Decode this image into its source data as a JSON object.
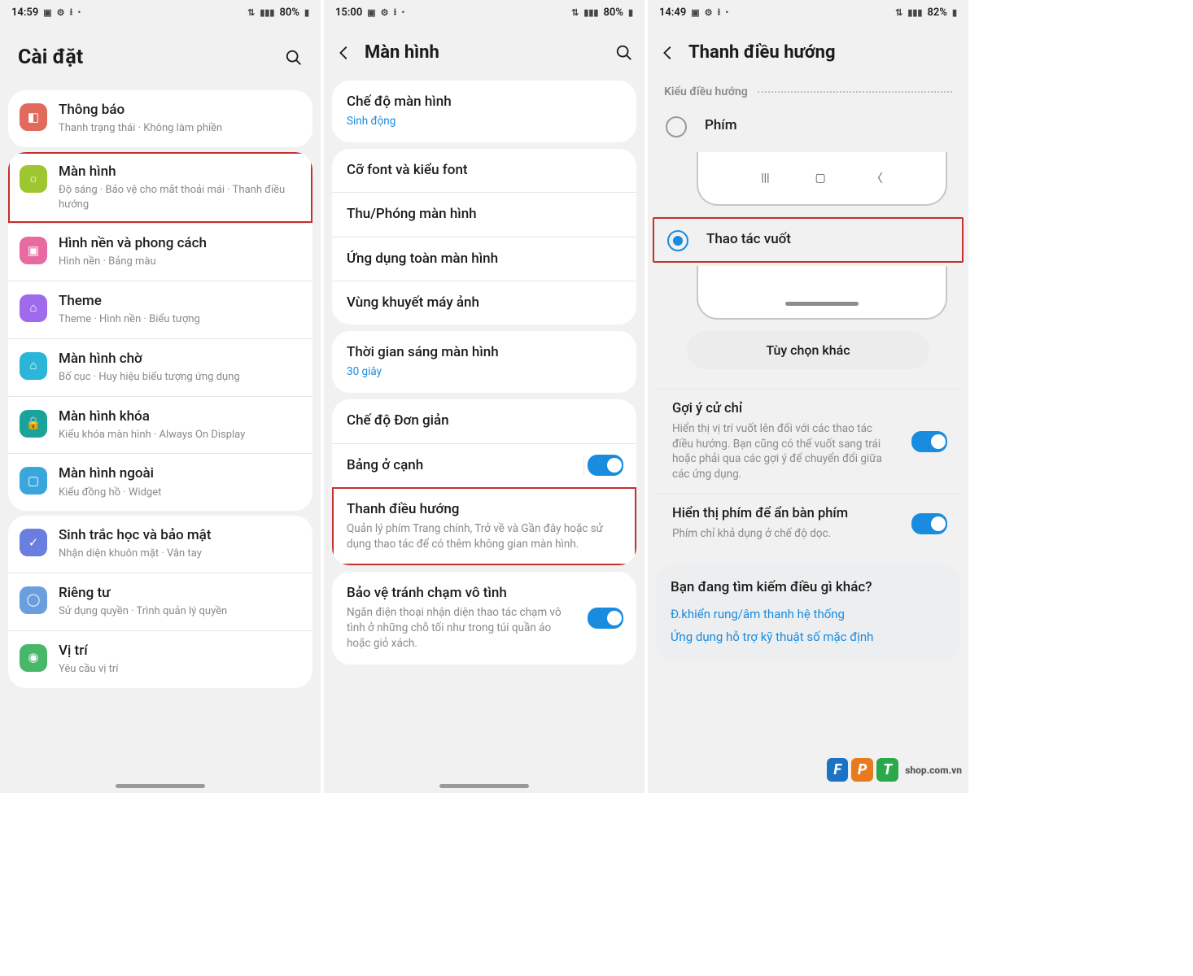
{
  "pane1": {
    "status": {
      "time": "14:59",
      "battery": "80%",
      "icons": [
        "image",
        "gear",
        "download",
        "dot"
      ]
    },
    "title": "Cài đặt",
    "groups": [
      [
        {
          "icon_bg": "#e26a5c",
          "glyph": "◧",
          "title": "Thông báo",
          "sub": "Thanh trạng thái  ·  Không làm phiền"
        }
      ],
      [
        {
          "icon_bg": "#9ec631",
          "glyph": "☼",
          "title": "Màn hình",
          "sub": "Độ sáng  ·  Bảo vệ cho mắt thoải mái  ·  Thanh điều hướng",
          "highlight": true
        },
        {
          "icon_bg": "#e76aa0",
          "glyph": "▣",
          "title": "Hình nền và phong cách",
          "sub": "Hình nền  ·  Bảng màu"
        },
        {
          "icon_bg": "#9f6aec",
          "glyph": "⌂",
          "title": "Theme",
          "sub": "Theme  ·  Hình nền  ·  Biểu tượng"
        },
        {
          "icon_bg": "#2bb5d8",
          "glyph": "⌂",
          "title": "Màn hình chờ",
          "sub": "Bố cục  ·  Huy hiệu biểu tượng ứng dụng"
        },
        {
          "icon_bg": "#1aa39a",
          "glyph": "🔒",
          "title": "Màn hình khóa",
          "sub": "Kiểu khóa màn hình  ·  Always On Display"
        },
        {
          "icon_bg": "#3aa6db",
          "glyph": "▢",
          "title": "Màn hình ngoài",
          "sub": "Kiểu đồng hồ  ·  Widget"
        }
      ],
      [
        {
          "icon_bg": "#6a7edf",
          "glyph": "✓",
          "title": "Sinh trắc học và bảo mật",
          "sub": "Nhận diện khuôn mặt  ·  Vân tay"
        },
        {
          "icon_bg": "#6a9edf",
          "glyph": "◯",
          "title": "Riêng tư",
          "sub": "Sử dụng quyền  ·  Trình quản lý quyền"
        },
        {
          "icon_bg": "#49b76a",
          "glyph": "◉",
          "title": "Vị trí",
          "sub": "Yêu cầu vị trí"
        }
      ]
    ]
  },
  "pane2": {
    "status": {
      "time": "15:00",
      "battery": "80%"
    },
    "title": "Màn hình",
    "groups": [
      [
        {
          "title": "Chế độ màn hình",
          "sub": "Sinh động",
          "sub_blue": true
        }
      ],
      [
        {
          "title": "Cỡ font và kiểu font"
        },
        {
          "title": "Thu/Phóng màn hình"
        },
        {
          "title": "Ứng dụng toàn màn hình"
        },
        {
          "title": "Vùng khuyết máy ảnh"
        }
      ],
      [
        {
          "title": "Thời gian sáng màn hình",
          "sub": "30 giây",
          "sub_blue": true
        }
      ],
      [
        {
          "title": "Chế độ Đơn giản"
        },
        {
          "title": "Bảng ở cạnh",
          "toggle": true,
          "toggle_divider": true
        },
        {
          "title": "Thanh điều hướng",
          "sub": "Quản lý phím Trang chính, Trở về và Gần đây hoặc sử dụng thao tác để có thêm không gian màn hình.",
          "highlight": true
        }
      ],
      [
        {
          "title": "Bảo vệ tránh chạm vô tình",
          "sub": "Ngăn điện thoại nhận diện thao tác chạm vô tình ở những chỗ tối như trong túi quần áo hoặc giỏ xách.",
          "toggle": true
        }
      ]
    ]
  },
  "pane3": {
    "status": {
      "time": "14:49",
      "battery": "82%"
    },
    "title": "Thanh điều hướng",
    "section": "Kiểu điều hướng",
    "opt_buttons": "Phím",
    "opt_gesture": "Thao tác vuốt",
    "more": "Tùy chọn khác",
    "hint_title": "Gợi ý cử chỉ",
    "hint_sub": "Hiển thị vị trí vuốt lên đối với các thao tác điều hướng. Bạn cũng có thể vuốt sang trái hoặc phải qua các gợi ý để chuyển đổi giữa các ứng dụng.",
    "hide_kb_title": "Hiển thị phím để ẩn bàn phím",
    "hide_kb_sub": "Phím chỉ khả dụng ở chế độ dọc.",
    "tip_q": "Bạn đang tìm kiếm điều gì khác?",
    "tip_links": [
      "Đ.khiển rung/âm thanh hệ thống",
      "Ứng dụng hỗ trợ kỹ thuật số mặc định"
    ],
    "logo_shop": "shop.com.vn"
  }
}
